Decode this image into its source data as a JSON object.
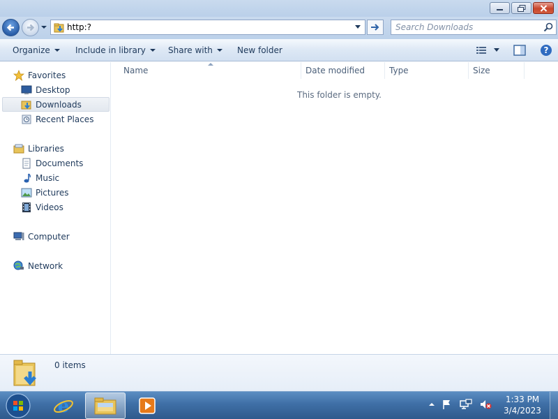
{
  "window": {
    "minimize_icon": "minimize-icon",
    "maximize_icon": "restore-icon",
    "close_icon": "close-icon"
  },
  "address_bar": {
    "value": "http:?",
    "search_placeholder": "Search Downloads"
  },
  "command_bar": {
    "organize": "Organize",
    "include_in_library": "Include in library",
    "share_with": "Share with",
    "new_folder": "New folder"
  },
  "nav_pane": {
    "favorites": {
      "label": "Favorites",
      "items": [
        "Desktop",
        "Downloads",
        "Recent Places"
      ]
    },
    "libraries": {
      "label": "Libraries",
      "items": [
        "Documents",
        "Music",
        "Pictures",
        "Videos"
      ]
    },
    "computer": "Computer",
    "network": "Network",
    "selected": "Downloads"
  },
  "columns": [
    "Name",
    "Date modified",
    "Type",
    "Size"
  ],
  "content": {
    "empty_message": "This folder is empty."
  },
  "details": {
    "item_count": "0 items"
  },
  "taskbar": {
    "time": "1:33 PM",
    "date": "3/4/2023",
    "pinned": [
      "internet-explorer-icon",
      "windows-explorer-icon",
      "media-player-icon"
    ]
  },
  "colors": {
    "accent": "#1e395b",
    "titlebar": "#c9daee",
    "taskbar": "#3f6fa6"
  }
}
